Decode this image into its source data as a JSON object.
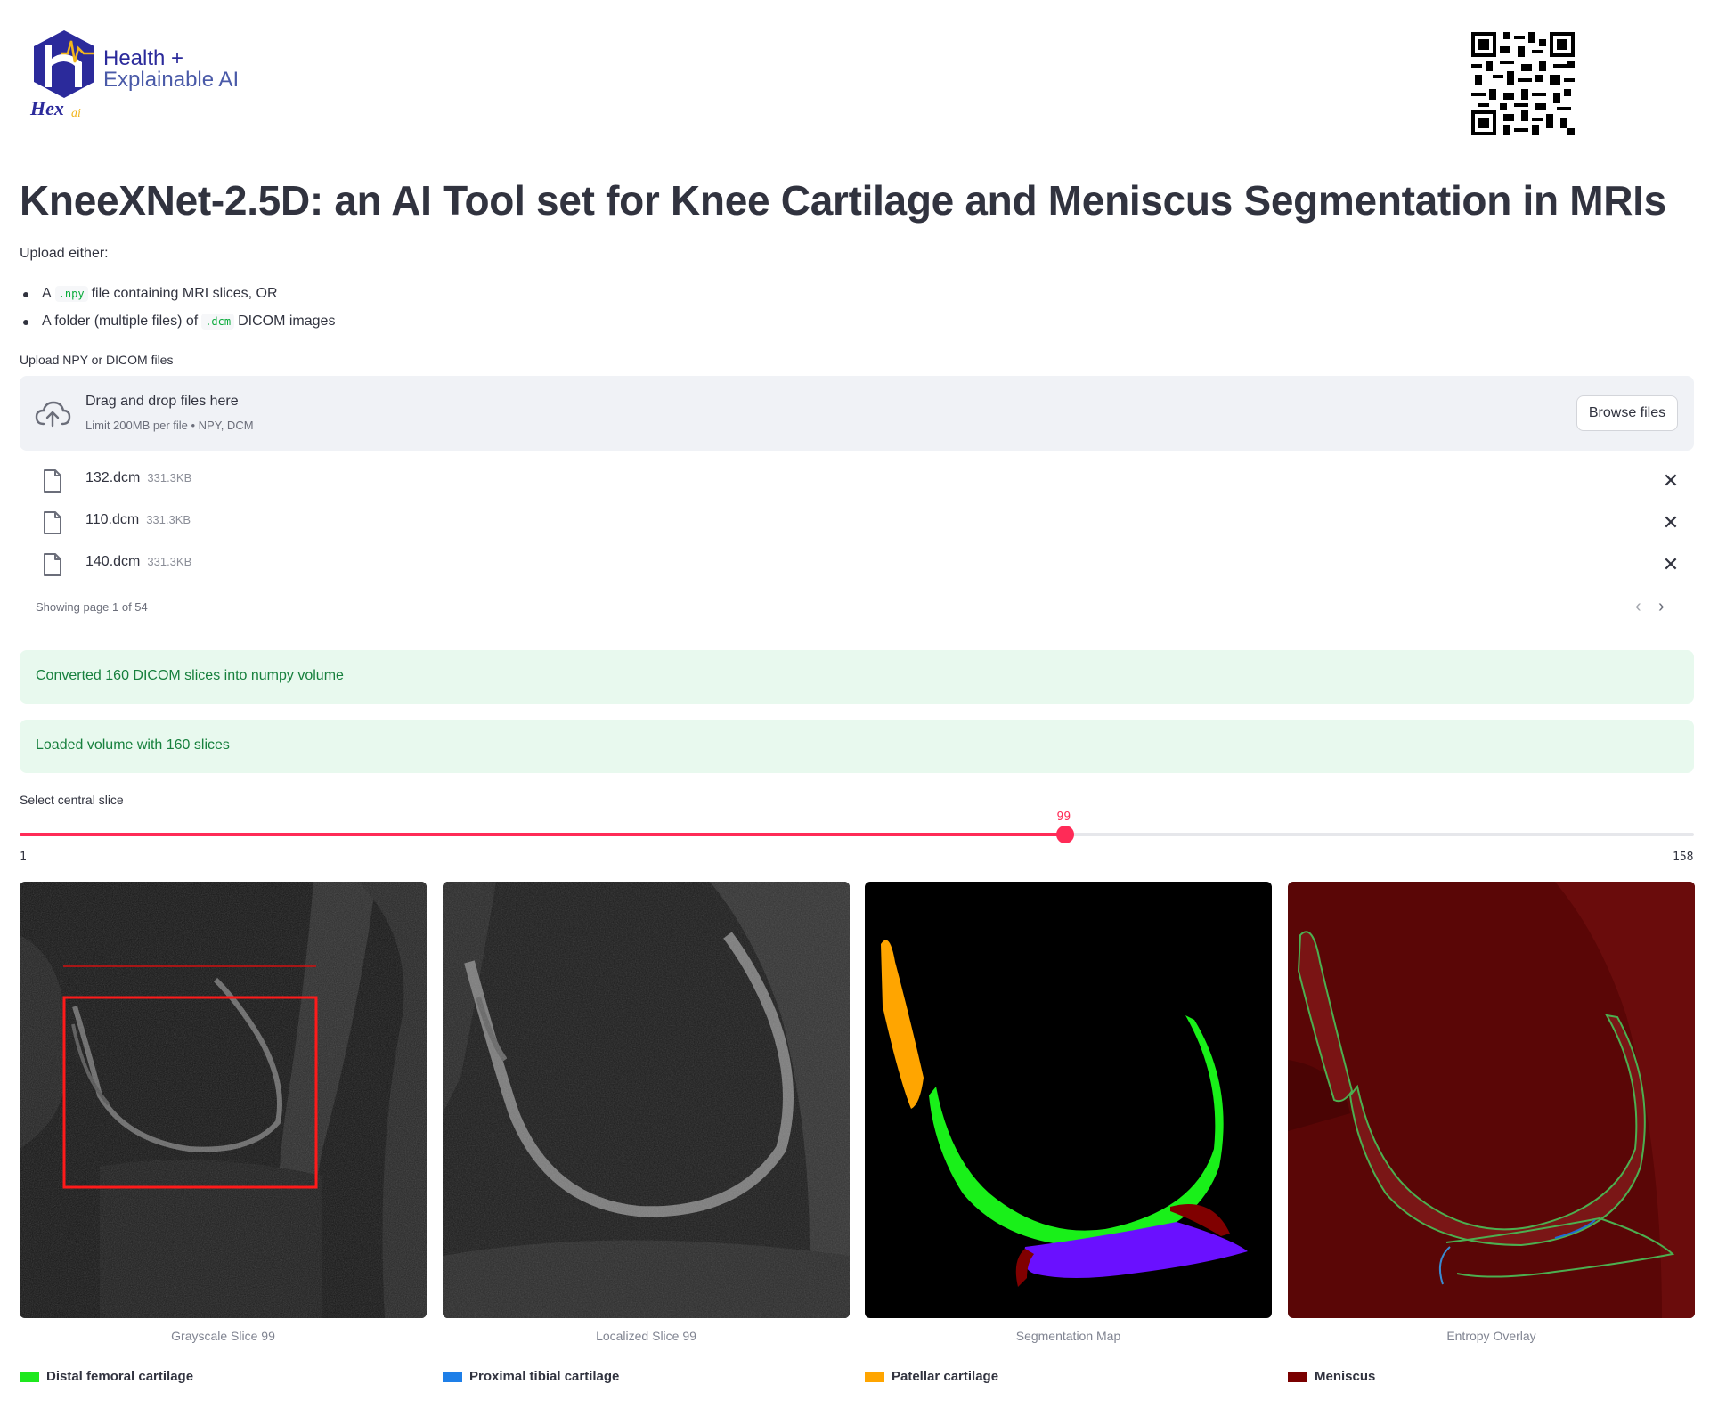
{
  "header": {
    "logo_line1": "Health +",
    "logo_line2": "Explainable AI",
    "logo_wordmark": "Hex",
    "logo_wordmark_suffix": "ai"
  },
  "title": "KneeXNet-2.5D: an AI Tool set for Knee Cartilage and Meniscus Segmentation in MRIs",
  "intro": {
    "upload_either": "Upload either:",
    "bullet1_pre": "A",
    "bullet1_code": ".npy",
    "bullet1_post": "file containing MRI slices, OR",
    "bullet2_pre": "A folder (multiple files) of",
    "bullet2_code": ".dcm",
    "bullet2_post": "DICOM images"
  },
  "uploader": {
    "label": "Upload NPY or DICOM files",
    "drop_title": "Drag and drop files here",
    "drop_limit": "Limit 200MB per file • NPY, DCM",
    "browse_label": "Browse files",
    "files": [
      {
        "name": "132.dcm",
        "size": "331.3KB"
      },
      {
        "name": "110.dcm",
        "size": "331.3KB"
      },
      {
        "name": "140.dcm",
        "size": "331.3KB"
      }
    ],
    "paging": "Showing page 1 of 54"
  },
  "messages": {
    "converted": "Converted 160 DICOM slices into numpy volume",
    "loaded": "Loaded volume with 160 slices"
  },
  "slider": {
    "label": "Select central slice",
    "min": 1,
    "max": 158,
    "value": 99,
    "min_label": "1",
    "max_label": "158",
    "value_label": "99",
    "accent": "#ff2b57"
  },
  "panels": {
    "captions": [
      "Grayscale Slice 99",
      "Localized Slice 99",
      "Segmentation Map",
      "Entropy Overlay"
    ]
  },
  "legend": [
    {
      "label": "Distal femoral cartilage",
      "color": "#1ee81e"
    },
    {
      "label": "Proximal tibial cartilage",
      "color": "#1e7fe8"
    },
    {
      "label": "Patellar cartilage",
      "color": "#ffa500"
    },
    {
      "label": "Meniscus",
      "color": "#7a0000"
    }
  ]
}
